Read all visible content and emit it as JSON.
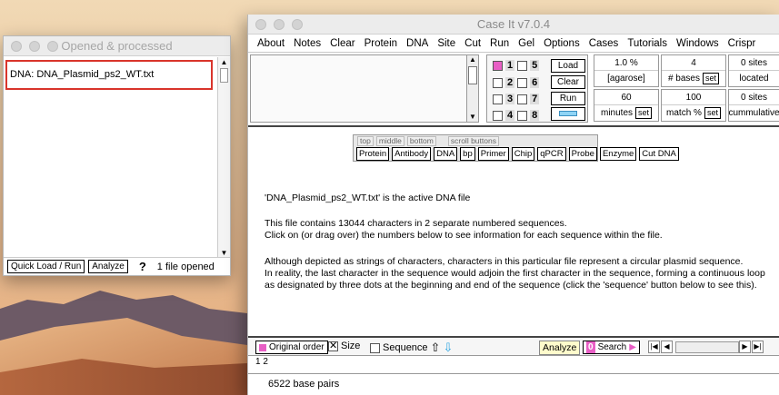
{
  "left_window": {
    "title": "Opened & processed",
    "list_item": "DNA: DNA_Plasmid_ps2_WT.txt",
    "quick_load_label": "Quick Load / Run",
    "analyze_label": "Analyze",
    "help_label": "?",
    "files_opened": "1  file opened"
  },
  "main_window": {
    "title": "Case It v7.0.4",
    "menu": [
      "About",
      "Notes",
      "Clear",
      "Protein",
      "DNA",
      "Site",
      "Cut",
      "Run",
      "Gel",
      "Options",
      "Cases",
      "Tutorials",
      "Windows",
      "Crispr"
    ],
    "lanes": {
      "numbers": [
        "1",
        "2",
        "3",
        "4",
        "5",
        "6",
        "7",
        "8"
      ],
      "checked_lane": "1",
      "load_label": "Load",
      "clear_label": "Clear",
      "run_label": "Run"
    },
    "params": {
      "agarose_value": "1.0 %",
      "agarose_label": "[agarose]",
      "minutes_value": "60",
      "minutes_label": "minutes",
      "bases_value": "4",
      "bases_label": "# bases",
      "match_value": "100",
      "match_label": "match %",
      "sites_located_value": "0  sites",
      "sites_located_label": "located",
      "sites_cumulative_value": "0  sites",
      "sites_cumulative_label": "cummulative",
      "set_label": "set"
    },
    "scroll_panel": {
      "top_label": "top",
      "middle_label": "middle",
      "bottom_label": "bottom",
      "scroll_buttons_label": "scroll buttons",
      "buttons": [
        "Protein",
        "Antibody",
        "DNA",
        "bp",
        "Primer",
        "Chip",
        "qPCR",
        "Probe",
        "Enzyme",
        "Cut DNA"
      ]
    },
    "messages": {
      "line1": "'DNA_Plasmid_ps2_WT.txt' is the active DNA file",
      "line2": "This file contains 13044 characters in 2 separate numbered sequences.",
      "line3": "Click on (or drag over) the numbers below to see information for each sequence within the file.",
      "line4": "Although depicted as strings of characters, characters in this particular file represent a circular plasmid sequence.",
      "line5": "In reality, the last character in the sequence would adjoin the first character in the sequence, forming a continuous loop",
      "line6": "as designated  by three dots at the beginning and end of the sequence (click the 'sequence' button below to see this)."
    },
    "bottom_bar": {
      "original_order_label": "Original order",
      "size_label": "Size",
      "sequence_label": "Sequence",
      "analyze_label": "Analyze",
      "search_badge": "0",
      "search_label": "Search"
    },
    "sequence_numbers": "1  2",
    "status": "6522 base pairs"
  },
  "colors": {
    "accent_red": "#d9342b",
    "lane_checked": "#e85fc5",
    "arrow_blue": "#2fa5e0"
  }
}
